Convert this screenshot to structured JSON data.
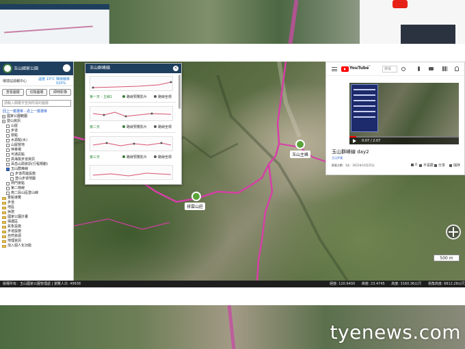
{
  "watermark": "tyenews.com",
  "sidebar": {
    "title": "玉山國家公園",
    "weather": {
      "location": "環境站週報中心",
      "temp_label": "溫度",
      "temp_value": "13°C",
      "rain_label": "降雨機率",
      "rain_value": "020%"
    },
    "buttons": [
      "查看圖層",
      "切換圖層",
      "即時影像"
    ],
    "search_placeholder": "請輸入關鍵字查詢所需的圖層",
    "nav_links": "回上一層選單 - 返上一層選單",
    "tree": [
      {
        "label": "國家公園範圍",
        "level": 0,
        "type": "expander"
      },
      {
        "label": "登山資訊",
        "level": 0,
        "type": "expander"
      },
      {
        "label": "山屋",
        "level": 1,
        "type": "check"
      },
      {
        "label": "步道",
        "level": 1,
        "type": "check"
      },
      {
        "label": "營點",
        "level": 1,
        "type": "check"
      },
      {
        "label": "水源點(水)",
        "level": 1,
        "type": "check"
      },
      {
        "label": "山屋營地",
        "level": 1,
        "type": "check"
      },
      {
        "label": "停車場",
        "level": 1,
        "type": "check"
      },
      {
        "label": "可通訊點",
        "level": 1,
        "type": "check"
      },
      {
        "label": "高海拔步道資訊",
        "level": 1,
        "type": "check"
      },
      {
        "label": "百岳山頭資訊(行程規劃)",
        "level": 1,
        "type": "check"
      },
      {
        "label": "玉山群峰線",
        "level": 1,
        "type": "check-on"
      },
      {
        "label": "步道周邊設施",
        "level": 2,
        "type": "check"
      },
      {
        "label": "登山步道地圖",
        "level": 2,
        "type": "check"
      },
      {
        "label": "熱門景點",
        "level": 1,
        "type": "check"
      },
      {
        "label": "第二條線",
        "level": 1,
        "type": "check"
      },
      {
        "label": "南二段山區登山線",
        "level": 1,
        "type": "check"
      },
      {
        "label": "景點導覽",
        "level": 0,
        "type": "folder"
      },
      {
        "label": "步道",
        "level": 0,
        "type": "folder"
      },
      {
        "label": "地區",
        "level": 0,
        "type": "folder"
      },
      {
        "label": "休憩",
        "level": 0,
        "type": "folder"
      },
      {
        "label": "國家公園計畫",
        "level": 0,
        "type": "folder"
      },
      {
        "label": "保護區",
        "level": 0,
        "type": "folder"
      },
      {
        "label": "氣象設施",
        "level": 0,
        "type": "folder"
      },
      {
        "label": "步道設施",
        "level": 0,
        "type": "folder"
      },
      {
        "label": "自然資源",
        "level": 0,
        "type": "folder"
      },
      {
        "label": "地理資訊",
        "level": 0,
        "type": "folder"
      },
      {
        "label": "加入個人化功能",
        "level": 0,
        "type": "folder"
      }
    ]
  },
  "route_panel": {
    "title": "玉山群峰線",
    "days": [
      {
        "label": "第一天 - 主線1",
        "link1": "路線預覽影片",
        "link2": "路線坐標"
      },
      {
        "label": "第二天",
        "link1": "路線預覽影片",
        "link2": "路線坐標"
      },
      {
        "label": "第三天",
        "link1": "路線預覽影片",
        "link2": "路線坐標"
      }
    ]
  },
  "map": {
    "markers": [
      {
        "label": "玉山主峰"
      },
      {
        "label": "排雲山莊"
      }
    ],
    "scale": "500 m"
  },
  "status_bar": {
    "left": "版權所有：玉山國家公園管理處 | 瀏覽人次: 49938",
    "right": [
      "經度: 120.9400",
      "緯度: 23.4745",
      "高度: 3160.36公尺",
      "視角高度: 6812.28公尺"
    ]
  },
  "youtube": {
    "search_placeholder": "搜尋",
    "region_badge": "TW",
    "video_title": "玉山群峰線 day2",
    "channel_tag": "玉山步道",
    "meta": "觀看次數：3次 · 2021年10月25日",
    "time": "0:07 / 2:07",
    "progress_pct": 6,
    "actions": [
      "0",
      "不喜歡",
      "分享",
      "儲存"
    ]
  }
}
